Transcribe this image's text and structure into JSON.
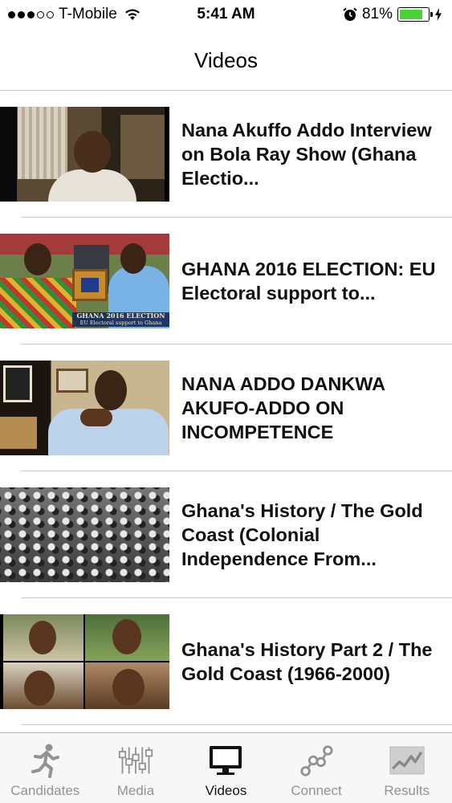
{
  "status_bar": {
    "carrier": "T-Mobile",
    "signal_filled": 3,
    "signal_total": 5,
    "time": "5:41 AM",
    "battery_percent_text": "81%",
    "battery_level": 0.81,
    "battery_color": "#4cd137"
  },
  "nav": {
    "title": "Videos"
  },
  "videos": [
    {
      "title": "Nana Akuffo Addo Interview on Bola Ray Show (Ghana Electio..."
    },
    {
      "title": "GHANA 2016 ELECTION: EU Electoral support to...",
      "thumb_caption": "GHANA 2016 ELECTION",
      "thumb_subcaption": "EU Electoral support to Ghana"
    },
    {
      "title": "NANA ADDO DANKWA AKUFO-ADDO ON INCOMPETENCE"
    },
    {
      "title": "Ghana's History / The Gold Coast (Colonial Independence From..."
    },
    {
      "title": "Ghana's History Part 2 / The Gold Coast (1966-2000)"
    }
  ],
  "tabs": [
    {
      "label": "Candidates",
      "icon": "runner-icon",
      "active": false
    },
    {
      "label": "Media",
      "icon": "sliders-icon",
      "active": false
    },
    {
      "label": "Videos",
      "icon": "monitor-icon",
      "active": true
    },
    {
      "label": "Connect",
      "icon": "connect-icon",
      "active": false
    },
    {
      "label": "Results",
      "icon": "chart-icon",
      "active": false
    }
  ],
  "colors": {
    "separator": "#c8c7cc",
    "tab_inactive": "#929292",
    "tab_active": "#111111"
  }
}
